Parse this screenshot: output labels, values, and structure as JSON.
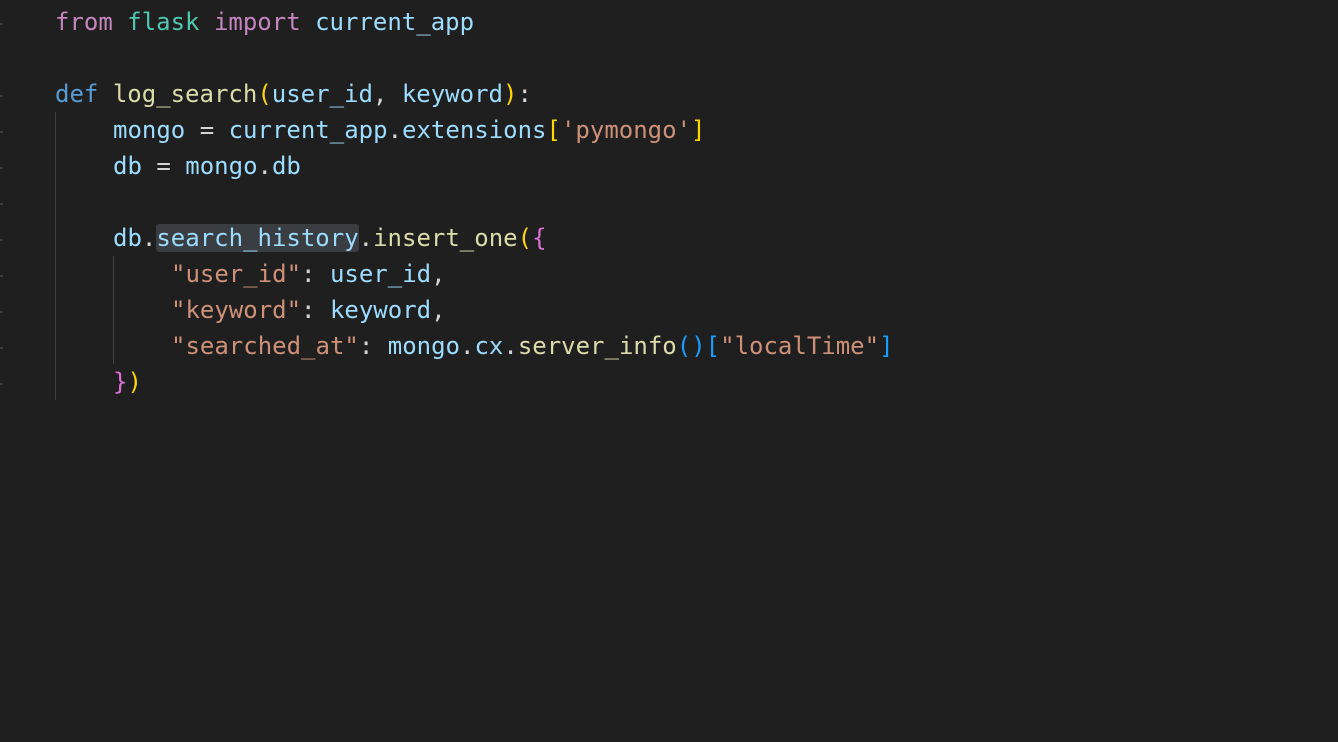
{
  "editor": {
    "language": "python",
    "theme_colors": {
      "background": "#1f1f1f",
      "keyword_control": "#c586c0",
      "keyword": "#569cd6",
      "module": "#4ec9b0",
      "variable": "#9cdcfe",
      "function": "#dcdcaa",
      "string": "#ce9178",
      "bracket_level1": "#ffd700",
      "bracket_level2": "#da70d6",
      "bracket_level3": "#179fff"
    },
    "tokens": {
      "from": "from",
      "flask": "flask",
      "import": "import",
      "current_app": "current_app",
      "def": "def",
      "log_search": "log_search",
      "user_id": "user_id",
      "keyword": "keyword",
      "mongo": "mongo",
      "extensions": "extensions",
      "pymongo_str": "'pymongo'",
      "db": "db",
      "search_history": "search_history",
      "insert_one": "insert_one",
      "user_id_str": "\"user_id\"",
      "keyword_str": "\"keyword\"",
      "searched_at_str": "\"searched_at\"",
      "cx": "cx",
      "server_info": "server_info",
      "localTime_str": "\"localTime\""
    }
  }
}
